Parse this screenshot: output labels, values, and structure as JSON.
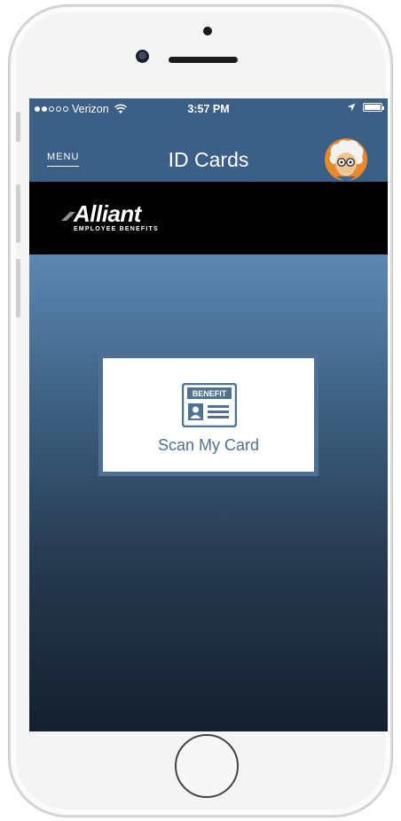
{
  "status_bar": {
    "carrier": "Verizon",
    "time": "3:57 PM"
  },
  "navbar": {
    "menu_label": "MENU",
    "title": "ID Cards"
  },
  "brand": {
    "name": "Alliant",
    "tagline": "EMPLOYEE BENEFITS"
  },
  "main": {
    "scan_button_label": "Scan My Card",
    "card_icon_text": "BENEFIT"
  },
  "colors": {
    "nav_bg": "#3c5f88",
    "accent": "#4f7293",
    "logo_band": "#000000"
  },
  "icons": [
    "wifi-icon",
    "location-arrow-icon",
    "battery-icon",
    "avatar-icon",
    "benefit-card-icon"
  ]
}
